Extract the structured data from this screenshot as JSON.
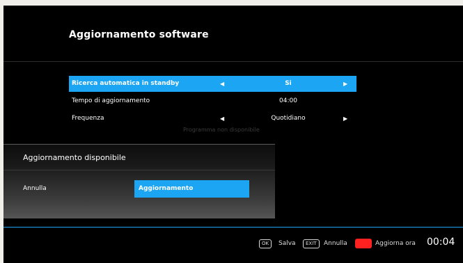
{
  "header": {
    "title": "Aggiornamento software"
  },
  "settings": [
    {
      "label": "Ricerca automatica in standby",
      "value": "Si",
      "selected": true
    },
    {
      "label": "Tempo di aggiornamento",
      "value": "04:00"
    },
    {
      "label": "Frequenza",
      "value": "Quotidiano"
    }
  ],
  "ghost_text": "Programma non disponibile",
  "dialog": {
    "title": "Aggiornamento disponibile",
    "cancel_label": "Annulla",
    "update_label": "Aggiornamento"
  },
  "footer": {
    "ok_key": "OK",
    "ok_label": "Salva",
    "exit_key": "EXIT",
    "exit_label": "Annulla",
    "red_label": "Aggiorna ora",
    "clock": "00:04"
  },
  "colors": {
    "accent": "#1ba5f2",
    "red_key": "#ff2020",
    "background": "#000000"
  }
}
